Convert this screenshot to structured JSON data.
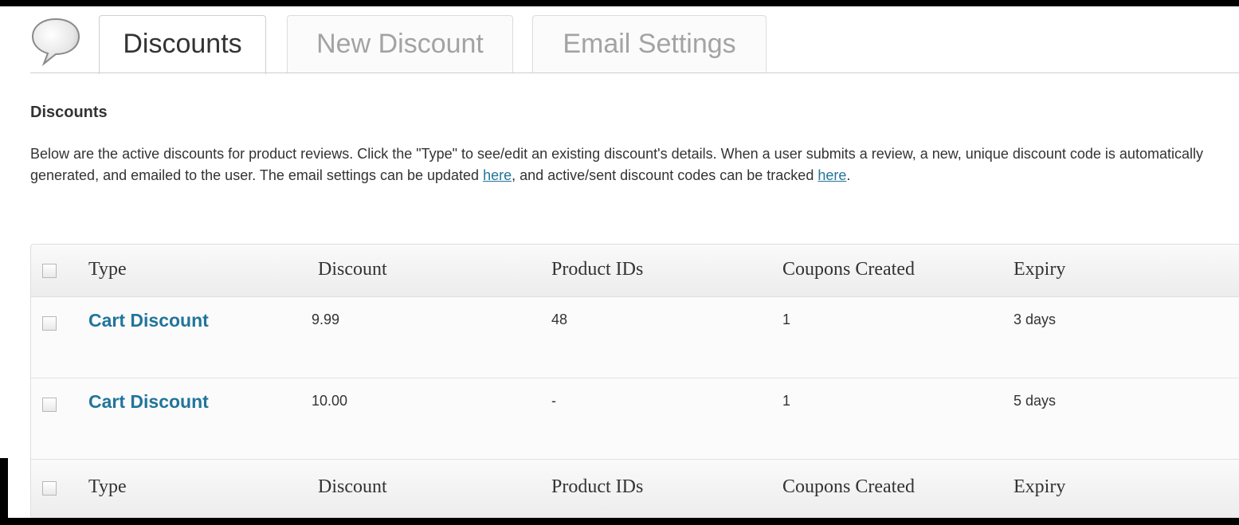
{
  "tabs": [
    {
      "label": "Discounts",
      "active": true
    },
    {
      "label": "New Discount",
      "active": false
    },
    {
      "label": "Email Settings",
      "active": false
    }
  ],
  "page": {
    "title": "Discounts",
    "intro_text_1": "Below are the active discounts for product reviews. Click the \"Type\" to see/edit an existing discount's details. When a user submits a review, a new, unique discount code is automatically generated, and emailed to the user. The email settings can be updated ",
    "intro_link_1": "here",
    "intro_text_2": ", and active/sent discount codes can be tracked ",
    "intro_link_2": "here",
    "intro_text_3": "."
  },
  "table": {
    "columns": [
      "Type",
      "Discount",
      "Product IDs",
      "Coupons Created",
      "Expiry"
    ],
    "rows": [
      {
        "type": "Cart Discount",
        "discount": "9.99",
        "product_ids": "48",
        "coupons_created": "1",
        "expiry": "3 days"
      },
      {
        "type": "Cart Discount",
        "discount": "10.00",
        "product_ids": "-",
        "coupons_created": "1",
        "expiry": "5 days"
      }
    ]
  },
  "colors": {
    "link": "#21759b",
    "text": "#333333",
    "inactive_tab_text": "#a3a3a3"
  },
  "icons": {
    "speech_bubble": "speech-bubble-icon"
  }
}
